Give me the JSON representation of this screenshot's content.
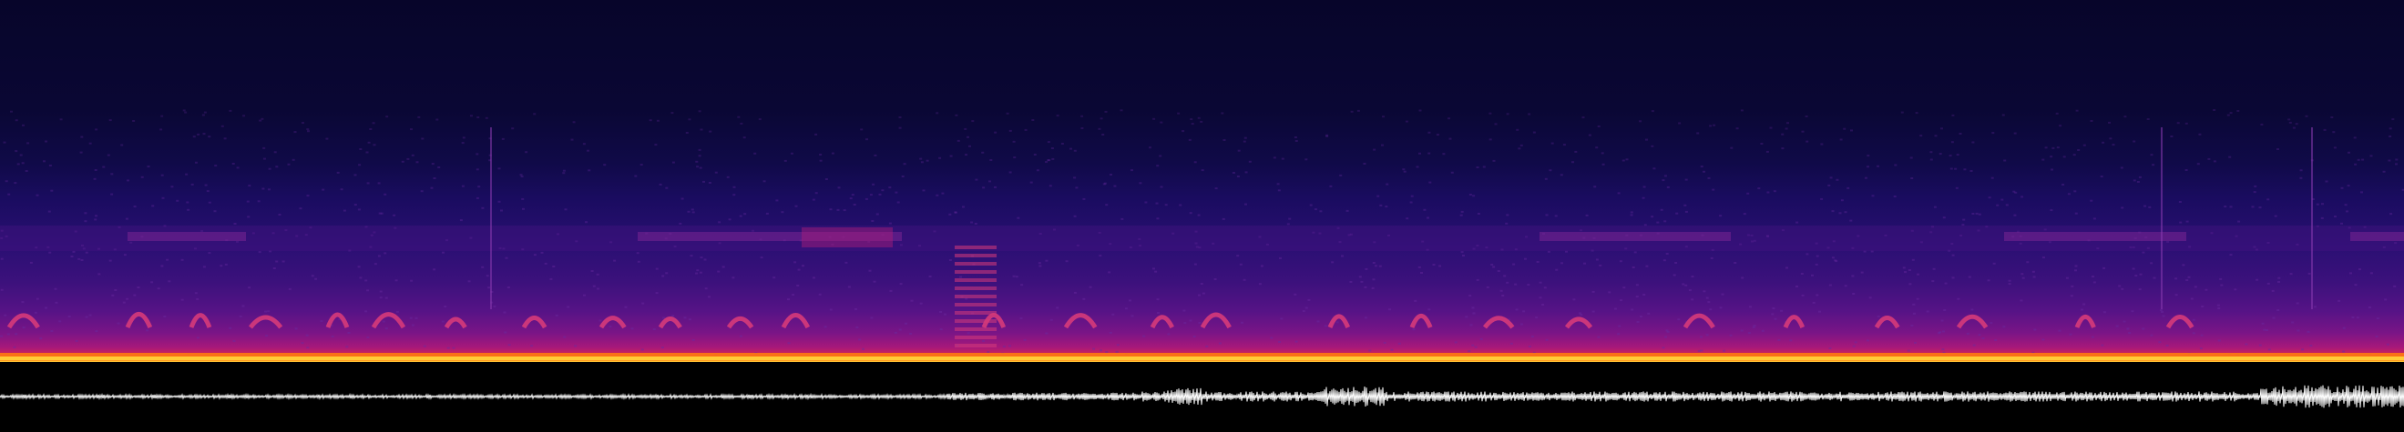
{
  "view": {
    "type": "audio-spectrogram-with-waveform",
    "colormap": "magma",
    "background": "#000000",
    "waveform_color": "#ffffff",
    "colors": {
      "noise_low": "#07052a",
      "noise_mid": "#2a0f73",
      "call_color": "#d63a7a",
      "floor_hot": "#ff7a10",
      "floor_peak": "#ffd23a"
    }
  }
}
